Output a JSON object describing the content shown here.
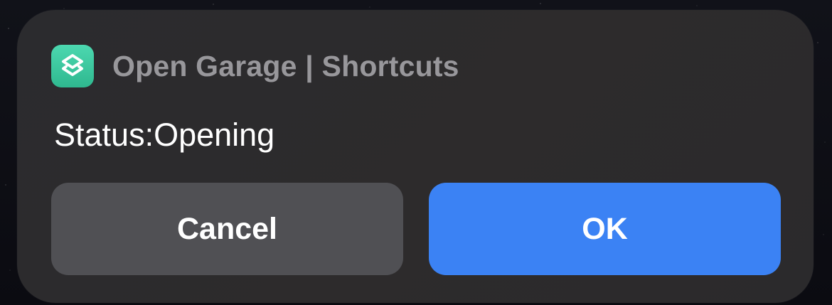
{
  "notification": {
    "app_icon": "shortcuts-icon",
    "app_title": "Open Garage | Shortcuts",
    "message": "Status:Opening"
  },
  "buttons": {
    "cancel_label": "Cancel",
    "ok_label": "OK"
  },
  "colors": {
    "panel_bg": "#2c2b2d",
    "icon_green": "#3ccaa0",
    "cancel_bg": "#505054",
    "ok_bg": "#3b82f4",
    "title_text": "#98979b",
    "body_text": "#ffffff"
  }
}
